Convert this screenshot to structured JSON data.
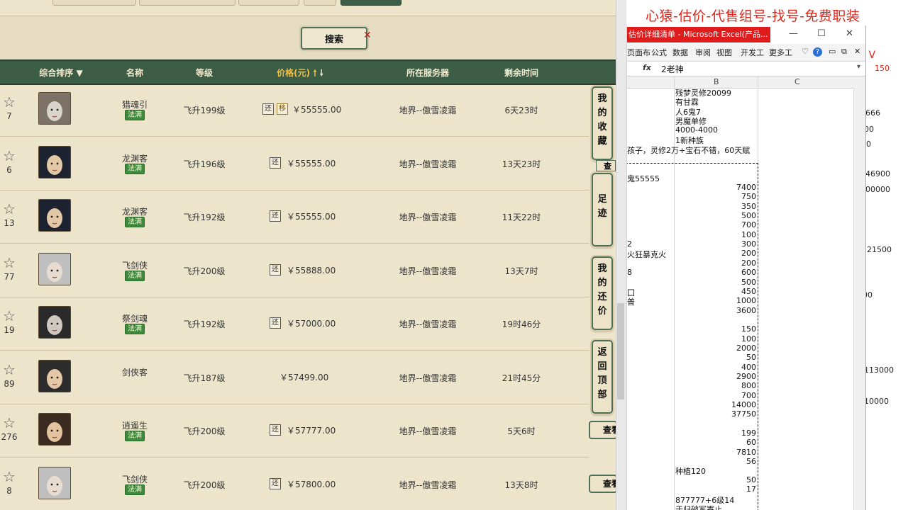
{
  "search": {
    "label": "搜索"
  },
  "table": {
    "headers": {
      "rank": "综合排序",
      "name": "名称",
      "level": "等级",
      "price": "价格(元)",
      "server": "所在服务器",
      "remain": "剩余时间"
    },
    "rows": [
      {
        "count": "7",
        "name": "猎魂引",
        "badge": "法满",
        "level": "飞升199级",
        "tags": [
          "还",
          "移"
        ],
        "price": "￥55555.00",
        "server": "地界--傲雪凌霜",
        "remain": "6天23时"
      },
      {
        "count": "6",
        "name": "龙渊客",
        "badge": "法满",
        "level": "飞升196级",
        "tags": [
          "还"
        ],
        "price": "￥55555.00",
        "server": "地界--傲雪凌霜",
        "remain": "13天23时"
      },
      {
        "count": "13",
        "name": "龙渊客",
        "badge": "法满",
        "level": "飞升192级",
        "tags": [
          "还"
        ],
        "price": "￥55555.00",
        "server": "地界--傲雪凌霜",
        "remain": "11天22时"
      },
      {
        "count": "77",
        "name": "飞剑侠",
        "badge": "法满",
        "level": "飞升200级",
        "tags": [
          "还"
        ],
        "price": "￥55888.00",
        "server": "地界--傲雪凌霜",
        "remain": "13天7时"
      },
      {
        "count": "19",
        "name": "祭剑魂",
        "badge": "法满",
        "level": "飞升192级",
        "tags": [
          "还"
        ],
        "price": "￥57000.00",
        "server": "地界--傲雪凌霜",
        "remain": "19时46分"
      },
      {
        "count": "89",
        "name": "剑侠客",
        "badge": "",
        "level": "飞升187级",
        "tags": [],
        "price": "￥57499.00",
        "server": "地界--傲雪凌霜",
        "remain": "21时45分"
      },
      {
        "count": "276",
        "name": "逍遥生",
        "badge": "法满",
        "level": "飞升200级",
        "tags": [
          "还"
        ],
        "price": "￥57777.00",
        "server": "地界--傲雪凌霜",
        "remain": "5天6时"
      },
      {
        "count": "8",
        "name": "飞剑侠",
        "badge": "法满",
        "level": "飞升200级",
        "tags": [
          "还"
        ],
        "price": "￥57800.00",
        "server": "地界--傲雪凌霜",
        "remain": "13天8时"
      }
    ]
  },
  "sidebar": {
    "favorites": [
      "我",
      "的",
      "收",
      "藏"
    ],
    "footprint": [
      "足",
      "迹"
    ],
    "my_offers": [
      "我",
      "的",
      "还",
      "价"
    ],
    "back_top": [
      "返",
      "回",
      "顶",
      "部"
    ],
    "view": "查看"
  },
  "doc": {
    "banner": "心猿-估价-代售组号-找号-免费职装",
    "right_values": [
      "加 V",
      "150",
      "666",
      "00",
      "00",
      "46900",
      "00000",
      "21500",
      "00",
      "113000",
      "10000"
    ]
  },
  "excel": {
    "title": "估价详细清单 - Microsoft Excel(产品...",
    "menu": [
      "页面布",
      "公式",
      "数据",
      "审阅",
      "视图",
      "开发工",
      "更多工"
    ],
    "fx": "fx",
    "cell_value": "2老神",
    "columns": [
      "B",
      "C"
    ],
    "text_cells": [
      "残梦灵修20099",
      "有甘霖",
      "人6鬼7",
      "男魔单修",
      "4000-4000",
      "1新种族",
      "孩子，灵修2万+宝石不错，60天赋"
    ],
    "col_a_cells": [
      "鬼55555",
      "2",
      "火狂暴克火",
      "8",
      "囗",
      "普"
    ],
    "numbers": [
      "7400",
      "750",
      "350",
      "500",
      "700",
      "100",
      "300",
      "200",
      "200",
      "600",
      "500",
      "450",
      "1000",
      "3600",
      "",
      "150",
      "100",
      "2000",
      "50",
      "400",
      "2900",
      "800",
      "700",
      "14000",
      "37750",
      "",
      "199",
      "60",
      "7810",
      "56"
    ],
    "bottom_text": [
      "种植120",
      "877777+6级14",
      "于归破军寄止"
    ],
    "bottom_numbers": [
      "50",
      "17"
    ]
  }
}
